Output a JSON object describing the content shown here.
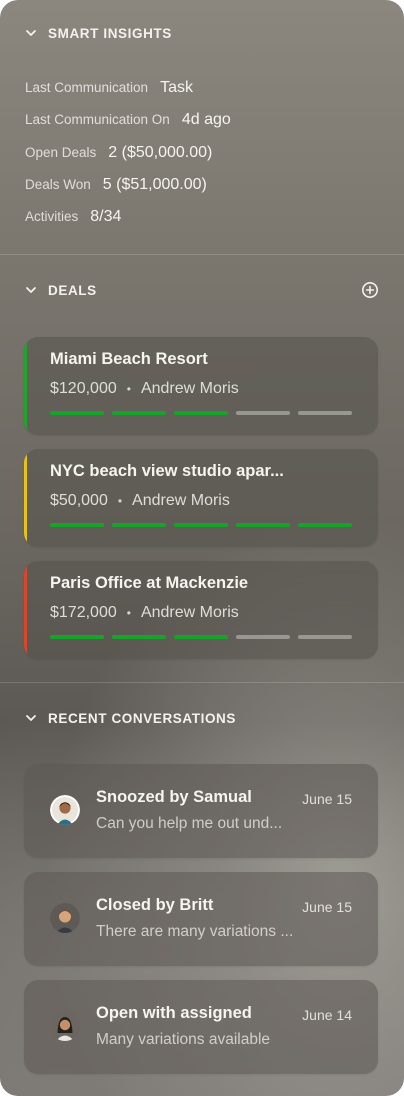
{
  "smart_insights": {
    "title": "SMART INSIGHTS",
    "rows": [
      {
        "label": "Last Communication",
        "value": "Task"
      },
      {
        "label": "Last Communication On",
        "value": "4d ago"
      },
      {
        "label": "Open Deals",
        "value": "2 ($50,000.00)"
      },
      {
        "label": "Deals Won",
        "value": "5 ($51,000.00)"
      },
      {
        "label": "Activities",
        "value": "8/34"
      }
    ]
  },
  "deals": {
    "title": "DEALS",
    "add_icon": "plus-circle-icon",
    "items": [
      {
        "name": "Miami Beach Resort",
        "amount": "$120,000",
        "separator": "•",
        "owner": "Andrew Moris",
        "accent_color": "#1fa52a",
        "stages_total": 5,
        "stages_completed": 3
      },
      {
        "name": "NYC beach view studio apar...",
        "amount": "$50,000",
        "separator": "•",
        "owner": "Andrew Moris",
        "accent_color": "#e8c21c",
        "stages_total": 5,
        "stages_completed": 5
      },
      {
        "name": "Paris Office at Mackenzie",
        "amount": "$172,000",
        "separator": "•",
        "owner": "Andrew Moris",
        "accent_color": "#d7472a",
        "stages_total": 5,
        "stages_completed": 3
      }
    ],
    "progress_complete_color": "#16a32a",
    "progress_incomplete_color": "#9a9792"
  },
  "recent_conversations": {
    "title": "RECENT CONVERSATIONS",
    "items": [
      {
        "title": "Snoozed by Samual",
        "date": "June 15",
        "preview": "Can you help me out und...",
        "avatar": "person-avatar-icon"
      },
      {
        "title": "Closed by Britt",
        "date": "June 15",
        "preview": "There are many variations ...",
        "avatar": "person-avatar-icon"
      },
      {
        "title": "Open with assigned",
        "date": "June 14",
        "preview": "Many variations available",
        "avatar": "person-avatar-icon"
      }
    ]
  }
}
